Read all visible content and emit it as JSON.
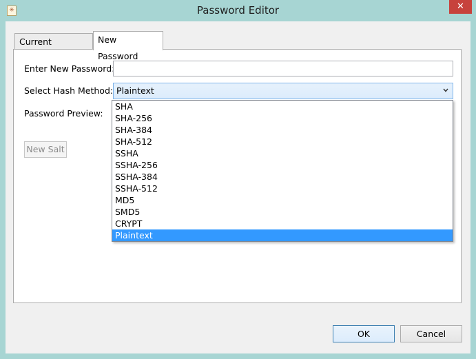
{
  "window": {
    "title": "Password Editor",
    "close_glyph": "✕"
  },
  "tabs": [
    {
      "label": "Current Password",
      "active": false
    },
    {
      "label": "New Password",
      "active": true
    }
  ],
  "form": {
    "new_password_label": "Enter New Password:",
    "new_password_value": "",
    "hash_method_label": "Select Hash Method:",
    "hash_method_value": "Plaintext",
    "preview_label": "Password Preview:",
    "new_salt_label": "New Salt"
  },
  "dropdown": {
    "options": [
      "SHA",
      "SHA-256",
      "SHA-384",
      "SHA-512",
      "SSHA",
      "SSHA-256",
      "SSHA-384",
      "SSHA-512",
      "MD5",
      "SMD5",
      "CRYPT",
      "Plaintext"
    ],
    "selected": "Plaintext"
  },
  "buttons": {
    "ok": "OK",
    "cancel": "Cancel"
  },
  "colors": {
    "selection": "#3399ff",
    "window_frame": "#a7d5d3",
    "close_button": "#c7423c"
  },
  "icons": {
    "app": "app-icon",
    "close": "close-icon",
    "dropdown": "chevron-down-icon"
  }
}
